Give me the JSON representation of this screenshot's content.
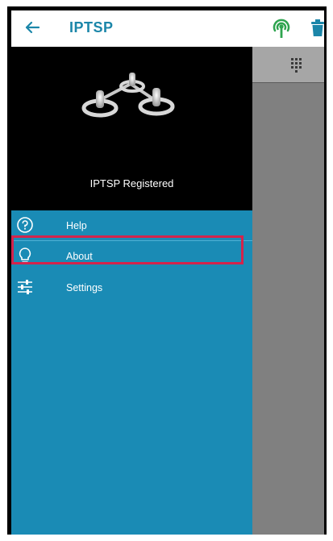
{
  "header": {
    "title": "IPTSP",
    "back_icon": "arrow-left-icon",
    "signal_icon": "broadcast-signal-icon",
    "trash_icon": "trash-icon",
    "accent": "#1b86a9",
    "signal_color": "#2ea44f"
  },
  "drawer": {
    "logo_icon": "network-nodes-logo",
    "status": "IPTSP Registered",
    "background": "#1a8bb5",
    "items": [
      {
        "label": "Help",
        "icon": "help-circle-icon"
      },
      {
        "label": "About",
        "icon": "lightbulb-icon"
      },
      {
        "label": "Settings",
        "icon": "sliders-icon",
        "highlighted": true
      }
    ],
    "highlight_color": "#d3244c"
  },
  "right_panel": {
    "dialpad_icon": "dialpad-icon"
  }
}
